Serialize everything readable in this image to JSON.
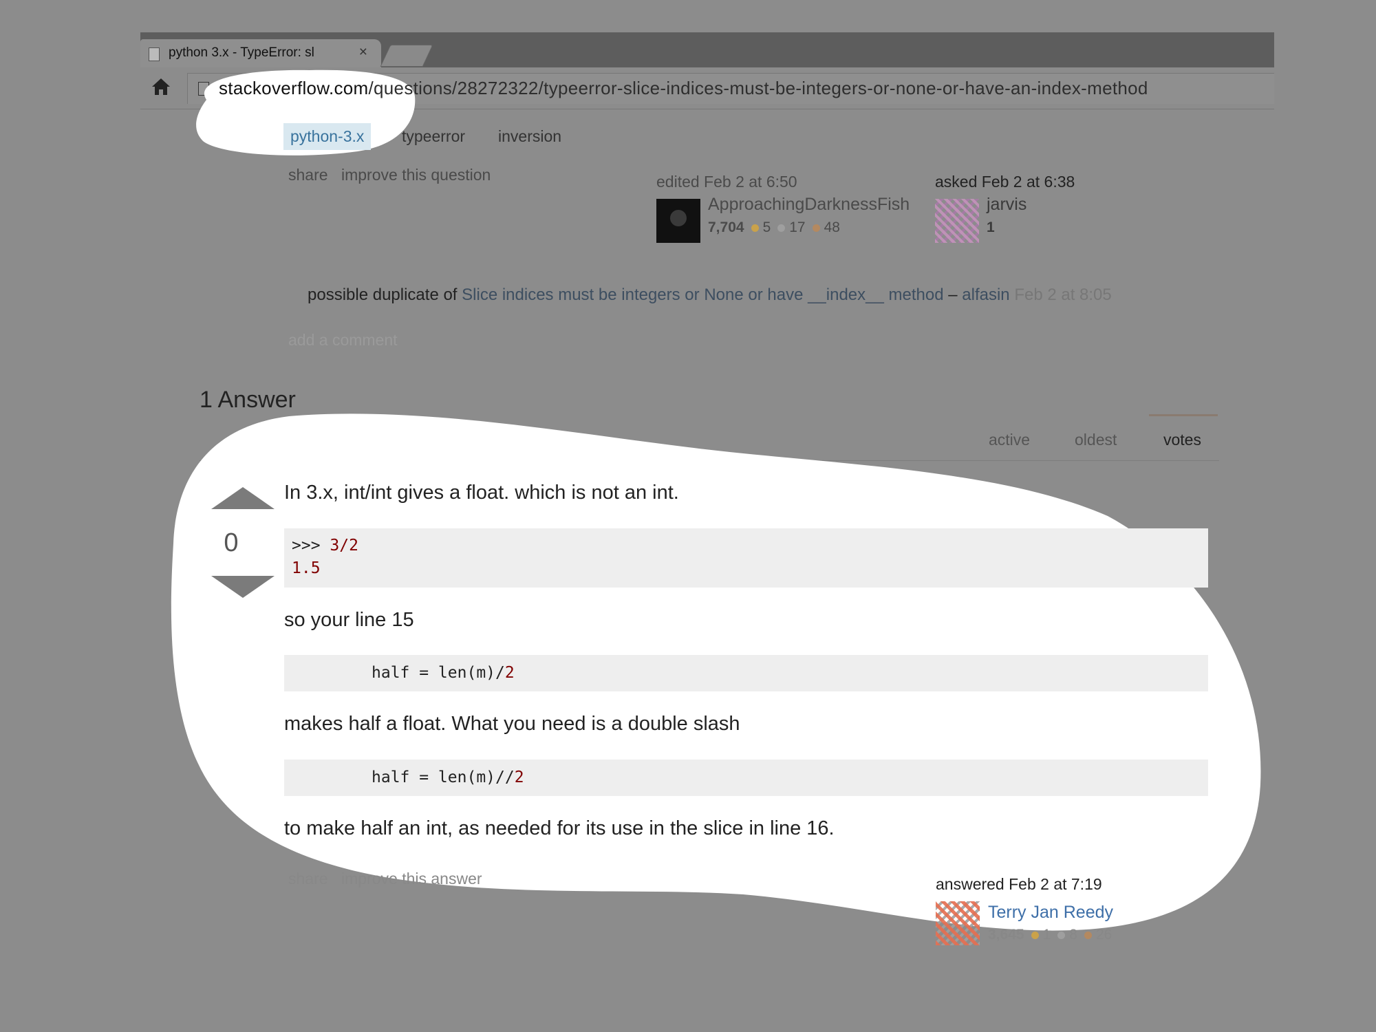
{
  "browser": {
    "tab_title": "python 3.x - TypeError: sl",
    "tab_close": "×",
    "url_host": "stackoverflow.com",
    "url_path": "/questions/28272322/typeerror-slice-indices-must-be-integers-or-none-or-have-an-index-method"
  },
  "question": {
    "tags": [
      "python-3.x",
      "typeerror",
      "inversion"
    ],
    "actions": {
      "share": "share",
      "improve": "improve this question"
    },
    "edited": {
      "label": "edited Feb 2 at 6:50",
      "user": "ApproachingDarknessFish",
      "rep": "7,704",
      "gold": "5",
      "silver": "17",
      "bronze": "48"
    },
    "asked": {
      "label": "asked Feb 2 at 6:38",
      "user": "jarvis",
      "rep": "1"
    },
    "comment": {
      "prefix": "possible duplicate of",
      "link": "Slice indices must be integers or None or have __index__ method",
      "sep": "–",
      "author": "alfasin",
      "time": "Feb 2 at 8:05"
    },
    "add_comment": "add a comment"
  },
  "answers": {
    "count_label": "1 Answer",
    "sort_tabs": [
      "active",
      "oldest",
      "votes"
    ],
    "active_sort": "votes"
  },
  "answer": {
    "votes": "0",
    "p1": "In 3.x, int/int gives a float. which is not an int.",
    "code1": {
      "prompt": ">>> ",
      "input": "3/2",
      "output": "1.5"
    },
    "p2": "so your line 15",
    "code2": {
      "text": "half = len(m)/",
      "num": "2"
    },
    "p3": "makes half a float. What you need is a double slash",
    "code3": {
      "text": "half = len(m)//",
      "num": "2"
    },
    "p4": "to make half an int, as needed for its use in the slice in line 16.",
    "actions": {
      "share": "share",
      "improve": "improve this answer"
    },
    "answered": {
      "label": "answered Feb 2 at 7:19",
      "user": "Terry Jan Reedy",
      "rep": "3,645",
      "gold": "1",
      "silver": "8",
      "bronze": "26"
    }
  },
  "colors": {
    "background": "#8c8c8c",
    "highlight": "#ffffff",
    "link": "#3e6fa8",
    "tag_bg": "#d9e8f0"
  }
}
